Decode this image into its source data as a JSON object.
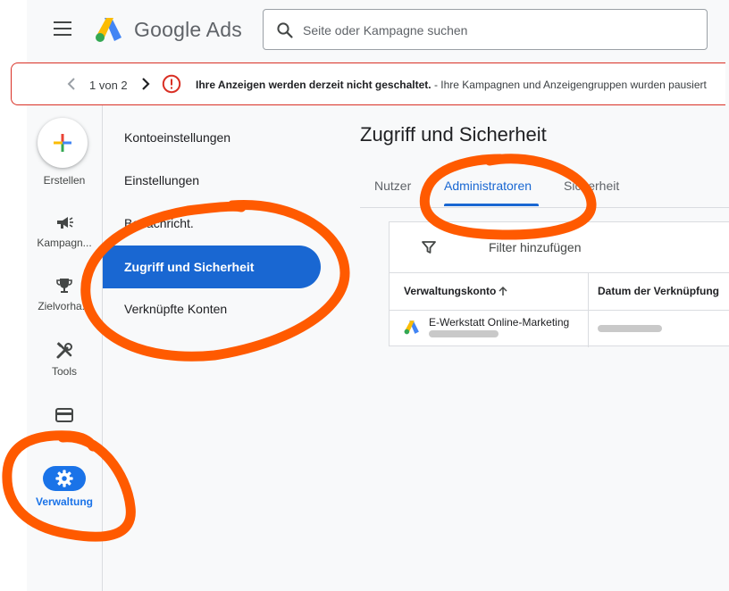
{
  "header": {
    "brand": "Google Ads",
    "search_placeholder": "Seite oder Kampagne suchen"
  },
  "alert": {
    "pager": "1 von 2",
    "headline": "Ihre Anzeigen werden derzeit nicht geschaltet.",
    "detail": " - Ihre Kampagnen und Anzeigengruppen wurden pausiert"
  },
  "rail": {
    "create": "Erstellen",
    "campaigns": "Kampagn...",
    "goals": "Zielvorha...",
    "tools": "Tools",
    "admin": "Verwaltung"
  },
  "subnav": {
    "items": [
      "Kontoeinstellungen",
      "Einstellungen",
      "Benachricht.",
      "Zugriff und Sicherheit",
      "Verknüpfte Konten"
    ]
  },
  "page": {
    "title": "Zugriff und Sicherheit",
    "tabs": [
      "Nutzer",
      "Administratoren",
      "Sicherheit"
    ]
  },
  "table": {
    "filter_label": "Filter hinzufügen",
    "columns": [
      "Verwaltungskonto",
      "Datum der Verknüpfung"
    ],
    "rows": [
      {
        "account": "E-Werkstatt Online-Marketing"
      }
    ]
  },
  "colors": {
    "accent": "#1a73e8",
    "active_nav": "#1967d2",
    "alert_red": "#d93025",
    "annotation_orange": "#ff5a00"
  }
}
